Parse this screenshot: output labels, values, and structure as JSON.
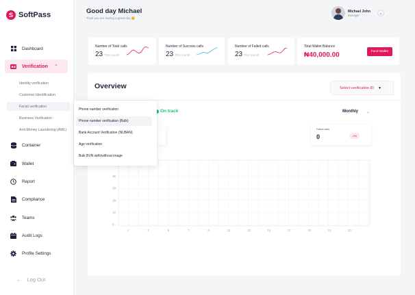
{
  "brand": {
    "name": "SoftPass",
    "accent": "#e0195f"
  },
  "sidebar": {
    "items": [
      {
        "label": "Dashboard",
        "icon": "grid-icon"
      },
      {
        "label": "Verification",
        "icon": "verification-icon"
      },
      {
        "label": "Container",
        "icon": "database-icon"
      },
      {
        "label": "Wallet",
        "icon": "wallet-icon"
      },
      {
        "label": "Report",
        "icon": "clock-icon"
      },
      {
        "label": "Compliance",
        "icon": "document-icon"
      },
      {
        "label": "Teams",
        "icon": "teams-icon"
      },
      {
        "label": "Audit Logs",
        "icon": "calendar-icon"
      },
      {
        "label": "Profile Settings",
        "icon": "gear-icon"
      }
    ],
    "sub_items": [
      "Identity verification",
      "Customer Identification",
      "Facial verification",
      "Business Verification",
      "Anti-Money Laundering (AML)"
    ],
    "logout": "Log Out"
  },
  "header": {
    "greeting": "Good day Michael",
    "subtitle": "Trust you are having a great day 😊",
    "user_name": "Michael John",
    "user_role": "Manager"
  },
  "stats": [
    {
      "label": "Number of Total calls",
      "value": "23",
      "period": "This month"
    },
    {
      "label": "Number of Success calls",
      "value": "23",
      "period": "This month"
    },
    {
      "label": "Number of Failed calls",
      "value": "23",
      "period": "This month"
    }
  ],
  "wallet": {
    "label": "Total Wallet Balance",
    "value": "₦40,000.00",
    "button": "Fund Wallet"
  },
  "overview": {
    "title": "Overview",
    "select": "Select verification ID",
    "status": "On track",
    "period": "Monthly",
    "failed": {
      "label": "Failed calls",
      "value": "0",
      "change": "-2%"
    }
  },
  "dropdown": [
    "Phone number verification",
    "Phone number verification (Bulk)",
    "Bank Account Verification (NUBAN)",
    "Age verification",
    "Bulk BVN with/without image"
  ],
  "chart_data": {
    "type": "line",
    "title": "",
    "xlabel": "",
    "ylabel": "",
    "x": [
      "1",
      "3",
      "5",
      "7",
      "9",
      "11",
      "13",
      "15",
      "17",
      "19",
      "21",
      "23"
    ],
    "y_ticks": [
      "0 -",
      "10",
      "20",
      "30",
      "40",
      "50"
    ],
    "ylim": [
      0,
      50
    ],
    "grid": true,
    "series": []
  }
}
